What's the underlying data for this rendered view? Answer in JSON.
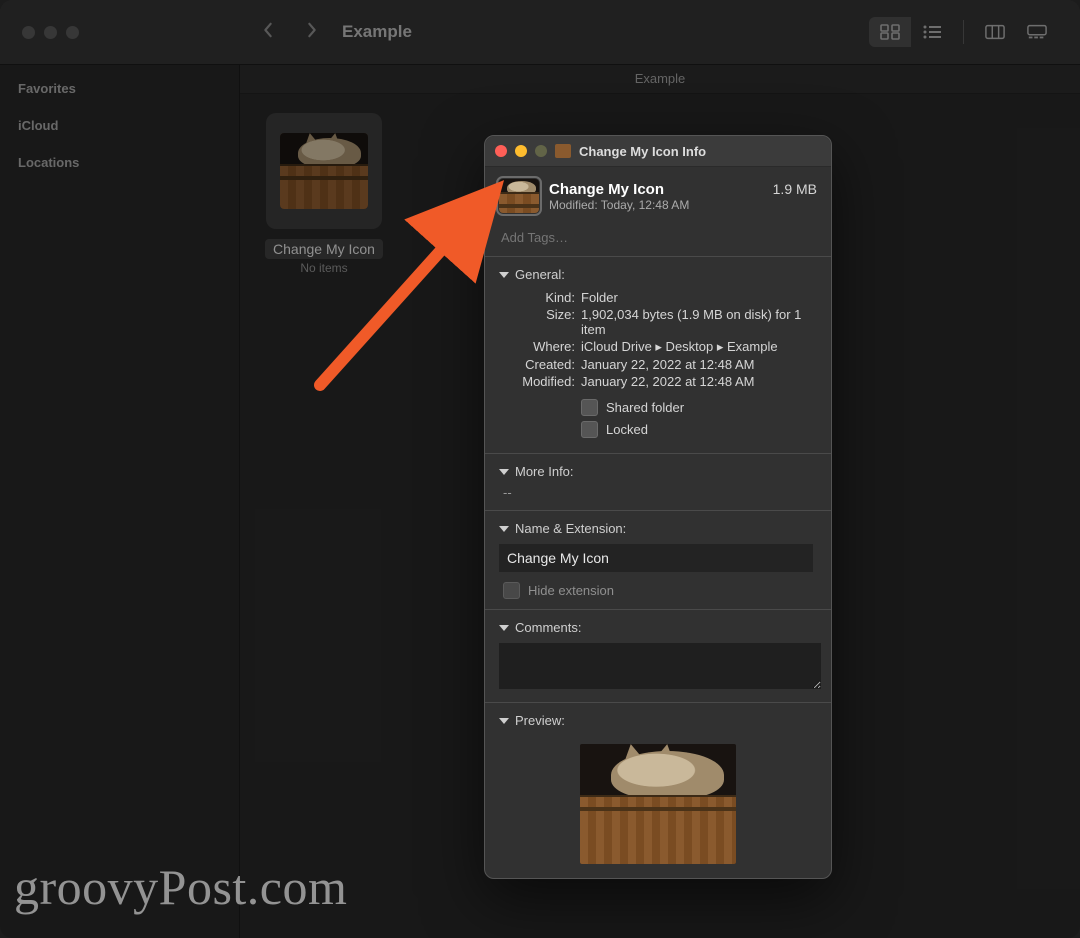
{
  "finder": {
    "title": "Example",
    "pathbar": "Example",
    "sidebar": {
      "sections": [
        "Favorites",
        "iCloud",
        "Locations"
      ]
    },
    "item": {
      "name": "Change My Icon",
      "subtitle": "No items"
    }
  },
  "info": {
    "window_title": "Change My Icon Info",
    "name": "Change My Icon",
    "modified_line": "Modified: Today, 12:48 AM",
    "size": "1.9 MB",
    "tags_placeholder": "Add Tags…",
    "sections": {
      "general_label": "General:",
      "moreinfo_label": "More Info:",
      "nameext_label": "Name & Extension:",
      "comments_label": "Comments:",
      "preview_label": "Preview:"
    },
    "general": {
      "kind_label": "Kind:",
      "kind": "Folder",
      "size_label": "Size:",
      "size": "1,902,034 bytes (1.9 MB on disk) for 1 item",
      "where_label": "Where:",
      "where": "iCloud Drive ▸ Desktop ▸ Example",
      "created_label": "Created:",
      "created": "January 22, 2022 at 12:48 AM",
      "modified_label": "Modified:",
      "modified": "January 22, 2022 at 12:48 AM",
      "shared_label": "Shared folder",
      "locked_label": "Locked"
    },
    "moreinfo_value": "--",
    "nameext_value": "Change My Icon",
    "hide_ext_label": "Hide extension"
  },
  "watermark": "groovyPost.com"
}
